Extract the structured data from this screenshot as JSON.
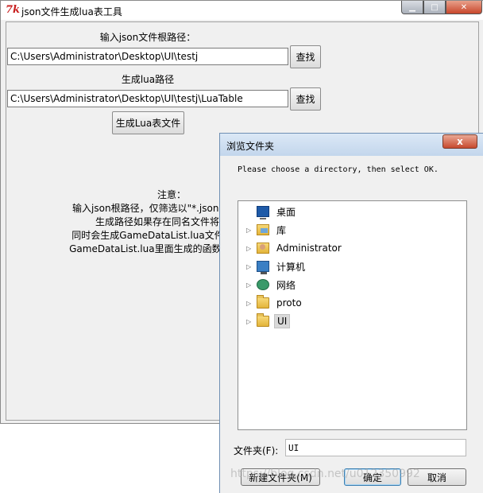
{
  "window": {
    "title": "json文件生成lua表工具",
    "icon_text": "7k"
  },
  "main": {
    "json_root_label": "输入json文件根路径：",
    "json_root_value": "C:\\Users\\Administrator\\Desktop\\UI\\testj",
    "find_button_1": "查找",
    "lua_path_label": "生成lua路径",
    "lua_path_value": "C:\\Users\\Administrator\\Desktop\\UI\\testj\\LuaTable",
    "find_button_2": "查找",
    "generate_button": "生成Lua表文件",
    "notes": [
      "注意：",
      "输入json根路径，仅筛选以\"*.json\"文件解析，",
      "生成路径如果存在同名文件将会被覆",
      "同时会生成GameDataList.lua文件，里面记录",
      "GameDataList.lua里面生成的函数可传入lua路"
    ]
  },
  "dialog": {
    "title": "浏览文件夹",
    "close_glyph": "x",
    "instruction": "Please choose a directory, then select OK.",
    "tree_items": [
      {
        "label": "桌面",
        "icon": "desktop-icon",
        "expandable": false
      },
      {
        "label": "库",
        "icon": "library-icon",
        "expandable": true
      },
      {
        "label": "Administrator",
        "icon": "user-folder-icon",
        "expandable": true
      },
      {
        "label": "计算机",
        "icon": "computer-icon",
        "expandable": true
      },
      {
        "label": "网络",
        "icon": "network-icon",
        "expandable": true
      },
      {
        "label": "proto",
        "icon": "folder-icon",
        "expandable": true
      },
      {
        "label": "UI",
        "icon": "folder-icon",
        "expandable": true,
        "selected": true
      }
    ],
    "folder_label": "文件夹(F):",
    "folder_value": "UI",
    "new_folder_button": "新建文件夹(M)",
    "ok_button": "确定",
    "cancel_button": "取消"
  },
  "watermark": "https://blog.csdn.net/u012350992"
}
